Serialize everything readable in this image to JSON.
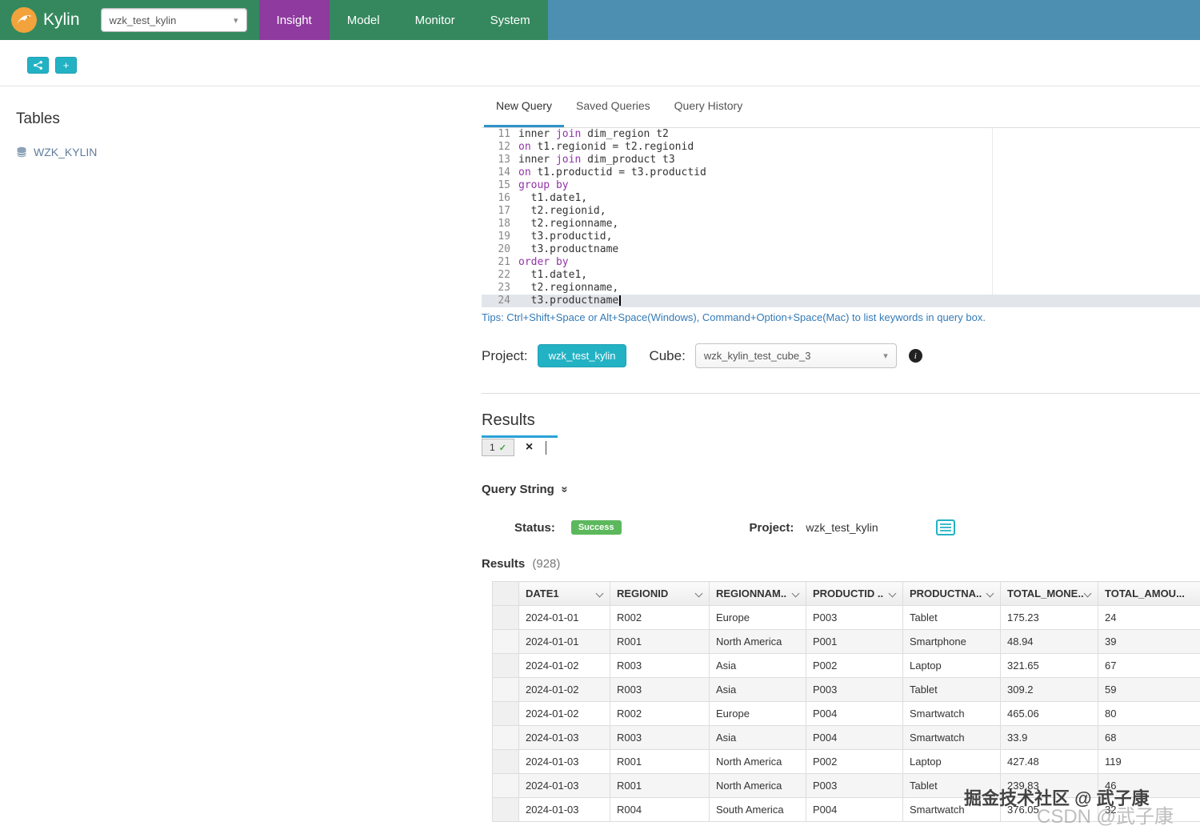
{
  "colors": {
    "nav_green": "#35885e",
    "nav_blue": "#4d8fb0",
    "nav_purple": "#8e3a9e",
    "accent_teal": "#23b2c4",
    "success_green": "#5cb85c",
    "link_blue": "#337ab7",
    "tab_underline": "#2f93c8",
    "keyword_purple": "#9333a8"
  },
  "navbar": {
    "brand": "Kylin",
    "project_select": "wzk_test_kylin",
    "items": [
      {
        "label": "Insight",
        "active": true
      },
      {
        "label": "Model",
        "active": false
      },
      {
        "label": "Monitor",
        "active": false
      },
      {
        "label": "System",
        "active": false
      }
    ]
  },
  "toolbar": {
    "add_glyph": "+"
  },
  "sidebar": {
    "title": "Tables",
    "tables": [
      "WZK_KYLIN"
    ]
  },
  "query_tabs": [
    "New Query",
    "Saved Queries",
    "Query History"
  ],
  "editor": {
    "active_line": 24,
    "lines": [
      {
        "no": 11,
        "code": "inner join dim_region t2"
      },
      {
        "no": 12,
        "code": "on t1.regionid = t2.regionid"
      },
      {
        "no": 13,
        "code": "inner join dim_product t3"
      },
      {
        "no": 14,
        "code": "on t1.productid = t3.productid"
      },
      {
        "no": 15,
        "code": "group by"
      },
      {
        "no": 16,
        "code": "  t1.date1,"
      },
      {
        "no": 17,
        "code": "  t2.regionid,"
      },
      {
        "no": 18,
        "code": "  t2.regionname,"
      },
      {
        "no": 19,
        "code": "  t3.productid,"
      },
      {
        "no": 20,
        "code": "  t3.productname"
      },
      {
        "no": 21,
        "code": "order by"
      },
      {
        "no": 22,
        "code": "  t1.date1,"
      },
      {
        "no": 23,
        "code": "  t2.regionname,"
      },
      {
        "no": 24,
        "code": "  t3.productname"
      }
    ],
    "tip": "Tips: Ctrl+Shift+Space or Alt+Space(Windows), Command+Option+Space(Mac) to list keywords in query box."
  },
  "query_meta": {
    "project_label": "Project:",
    "project_value": "wzk_test_kylin",
    "cube_label": "Cube:",
    "cube_value": "wzk_kylin_test_cube_3"
  },
  "results_section": {
    "title": "Results",
    "tab_label": "1",
    "query_string_label": "Query String",
    "status_label": "Status:",
    "status_value": "Success",
    "project_label": "Project:",
    "project_value": "wzk_test_kylin",
    "results_label": "Results",
    "results_count": "(928)"
  },
  "table": {
    "headers": [
      "",
      "DATE1",
      "REGIONID",
      "REGIONNAM..",
      "PRODUCTID ..",
      "PRODUCTNA..",
      "TOTAL_MONE..",
      "TOTAL_AMOU..."
    ],
    "rows": [
      [
        "2024-01-01",
        "R002",
        "Europe",
        "P003",
        "Tablet",
        "175.23",
        "24"
      ],
      [
        "2024-01-01",
        "R001",
        "North America",
        "P001",
        "Smartphone",
        "48.94",
        "39"
      ],
      [
        "2024-01-02",
        "R003",
        "Asia",
        "P002",
        "Laptop",
        "321.65",
        "67"
      ],
      [
        "2024-01-02",
        "R003",
        "Asia",
        "P003",
        "Tablet",
        "309.2",
        "59"
      ],
      [
        "2024-01-02",
        "R002",
        "Europe",
        "P004",
        "Smartwatch",
        "465.06",
        "80"
      ],
      [
        "2024-01-03",
        "R003",
        "Asia",
        "P004",
        "Smartwatch",
        "33.9",
        "68"
      ],
      [
        "2024-01-03",
        "R001",
        "North America",
        "P002",
        "Laptop",
        "427.48",
        "119"
      ],
      [
        "2024-01-03",
        "R001",
        "North America",
        "P003",
        "Tablet",
        "239.83",
        "46"
      ],
      [
        "2024-01-03",
        "R004",
        "South America",
        "P004",
        "Smartwatch",
        "376.05",
        "32"
      ]
    ]
  },
  "watermarks": [
    "掘金技术社区 @ 武子康",
    "CSDN @武子康"
  ]
}
